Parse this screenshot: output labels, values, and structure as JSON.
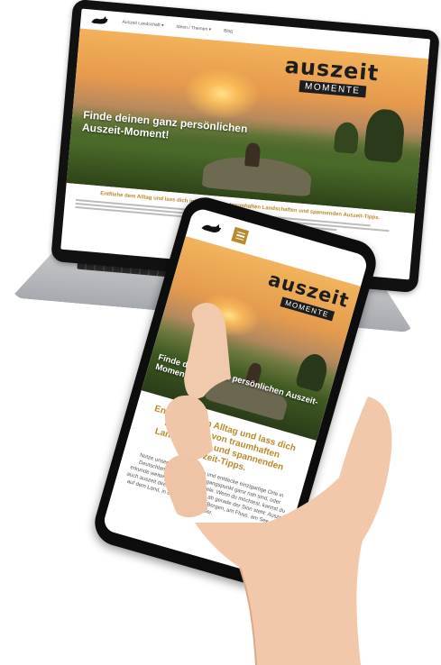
{
  "laptop": {
    "nav_items": [
      "Auszeit Landschaft ▾",
      "Ideen / Themen ▾",
      "Blog"
    ],
    "brand_main": "auszeit",
    "brand_sub": "MOMENTE",
    "hero_text": "Finde deinen ganz persönlichen Auszeit-Moment!",
    "heading": "Entfliehe dem Alltag und lass dich inspirieren von traumhaften Landschaften und spannenden Auszeit-Tipps."
  },
  "phone": {
    "brand_main": "auszeit",
    "brand_sub": "MOMENTE",
    "hero_text": "Finde deinen ganz persönlichen Auszeit-Moment!",
    "heading": "Entfliehe dem Alltag und lass dich inspirieren von traumhaften Landschaften und spannenden Auszeit-Tipps.",
    "body_text": "Nutze unsere Auszeit-Suche und entdecke einzigartige Orte in Deutschland, die deinem Ausgangspunkt ganz nah sind, oder erkunde weiter entfernte Traumziele. Wenn du möchtest, kannst du auch auszeit direkt wählen, einmal ab gerade der Sinn steht: Auszeit auf dem Land, in der Stadt, in den Bergen, am Fluss, am See oder am Meer."
  },
  "colors": {
    "accent": "#b98a2b",
    "dark": "#1d1d1d"
  }
}
